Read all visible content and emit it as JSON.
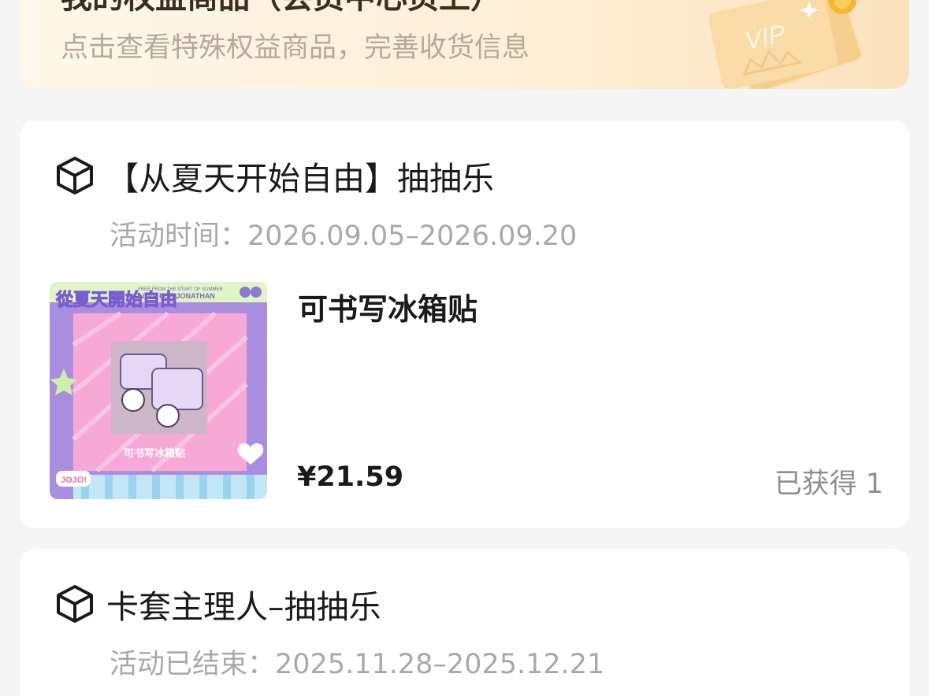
{
  "banner": {
    "title": "我的权益商品（会员中心页上）",
    "subtitle": "点击查看特殊权益商品，完善收货信息",
    "vip_badge": "VIP",
    "accent_color": "#fbe2bd"
  },
  "activities": [
    {
      "icon": "box-icon",
      "title": "【从夏天开始自由】抽抽乐",
      "time_label": "活动时间：2026.09.05–2026.09.20",
      "product": {
        "name": "可书写冰箱贴",
        "price": "¥21.59",
        "obtained": "已获得 1",
        "image": {
          "header_line1": "FREE FROM THE START OF SUMMER",
          "header_line2": "LOVE FOR JONATHAN",
          "logo": "從夏天開始自由",
          "caption": "可书写冰箱贴",
          "tag": "JOJO!"
        }
      }
    },
    {
      "icon": "box-icon",
      "title": "卡套主理人–抽抽乐",
      "time_label": "活动已结束：2025.11.28–2025.12.21"
    }
  ]
}
